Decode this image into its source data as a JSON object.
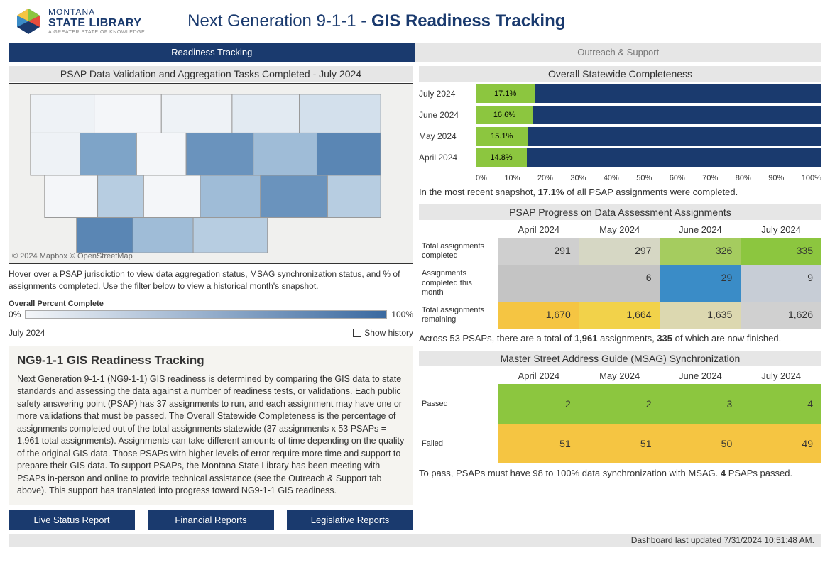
{
  "logo": {
    "l1": "MONTANA",
    "l2": "STATE LIBRARY",
    "l3": "A GREATER STATE OF KNOWLEDGE"
  },
  "page_title_prefix": "Next Generation 9-1-1 - ",
  "page_title_bold": "GIS Readiness Tracking",
  "tabs": {
    "active": "Readiness Tracking",
    "inactive": "Outreach & Support"
  },
  "map": {
    "title": "PSAP Data Validation and Aggregation Tasks Completed - July 2024",
    "attribution": "© 2024 Mapbox © OpenStreetMap",
    "help": "Hover over a PSAP jurisdiction to view data aggregation status, MSAG synchronization status, and % of assignments completed. Use the filter below to view a historical month's snapshot.",
    "legend_title": "Overall Percent Complete",
    "legend_min": "0%",
    "legend_max": "100%",
    "month": "July 2024",
    "show_history": "Show history"
  },
  "info": {
    "heading": "NG9-1-1 GIS Readiness Tracking",
    "body": "Next Generation 9-1-1 (NG9-1-1) GIS readiness is determined by comparing the GIS data to state standards and assessing the data against a number of readiness tests, or validations. Each public safety answering point (PSAP) has 37 assignments to run, and each assignment may have one or more validations that must be passed. The Overall Statewide Completeness is the percentage of assignments completed out of the total assignments statewide (37 assignments x 53 PSAPs = 1,961 total assignments). Assignments can take different amounts of time depending on the quality of the original GIS data. Those PSAPs with higher levels of error require more time and support to prepare their GIS data. To support PSAPs, the Montana State Library has been meeting with PSAPs in-person and online to provide technical assistance (see the Outreach & Support tab above).  This support has translated into progress toward NG9-1-1 GIS readiness."
  },
  "buttons": {
    "b1": "Live Status Report",
    "b2": "Financial Reports",
    "b3": "Legislative Reports"
  },
  "completeness": {
    "title": "Overall Statewide Completeness",
    "rows": [
      {
        "label": "July 2024",
        "pct": 17.1
      },
      {
        "label": "June 2024",
        "pct": 16.6
      },
      {
        "label": "May 2024",
        "pct": 15.1
      },
      {
        "label": "April 2024",
        "pct": 14.8
      }
    ],
    "axis": [
      "0%",
      "10%",
      "20%",
      "30%",
      "40%",
      "50%",
      "60%",
      "70%",
      "80%",
      "90%",
      "100%"
    ],
    "summary_prefix": "In the most recent snapshot, ",
    "summary_bold": "17.1%",
    "summary_suffix": " of all PSAP assignments were completed."
  },
  "progress": {
    "title": "PSAP Progress on Data Assessment Assignments",
    "months": [
      "April 2024",
      "May 2024",
      "June 2024",
      "July 2024"
    ],
    "rows": [
      {
        "label": "Total assignments completed",
        "vals": [
          "291",
          "297",
          "326",
          "335"
        ],
        "colors": [
          "#cfcfcf",
          "#d6d7c4",
          "#a5cc5f",
          "#8cc63f"
        ]
      },
      {
        "label": "Assignments completed this month",
        "vals": [
          "",
          "6",
          "29",
          "9"
        ],
        "colors": [
          "#c4c4c4",
          "#c4c4c4",
          "#3a8cc7",
          "#c7cdd6"
        ]
      },
      {
        "label": "Total assignments remaining",
        "vals": [
          "1,670",
          "1,664",
          "1,635",
          "1,626"
        ],
        "colors": [
          "#f5c542",
          "#f2d24a",
          "#dcd8b0",
          "#d0d0d0"
        ]
      }
    ],
    "summary_p1": "Across 53 PSAPs, there are a total of ",
    "summary_b1": "1,961",
    "summary_p2": " assignments, ",
    "summary_b2": "335",
    "summary_p3": " of which are now finished."
  },
  "msag": {
    "title": "Master Street Address Guide (MSAG) Synchronization",
    "months": [
      "April 2024",
      "May 2024",
      "June 2024",
      "July 2024"
    ],
    "rows": [
      {
        "label": "Passed",
        "vals": [
          "2",
          "2",
          "3",
          "4"
        ],
        "colors": [
          "#8cc63f",
          "#8cc63f",
          "#8cc63f",
          "#8cc63f"
        ]
      },
      {
        "label": "Failed",
        "vals": [
          "51",
          "51",
          "50",
          "49"
        ],
        "colors": [
          "#f5c542",
          "#f5c542",
          "#f5c542",
          "#f5c542"
        ]
      }
    ],
    "summary_p1": "To pass, PSAPs must have 98 to 100% data synchronization with MSAG. ",
    "summary_b1": "4",
    "summary_p2": " PSAPs passed."
  },
  "footer": "Dashboard last updated 7/31/2024 10:51:48 AM.",
  "chart_data": [
    {
      "type": "bar",
      "title": "Overall Statewide Completeness",
      "orientation": "horizontal",
      "categories": [
        "July 2024",
        "June 2024",
        "May 2024",
        "April 2024"
      ],
      "values": [
        17.1,
        16.6,
        15.1,
        14.8
      ],
      "xlim": [
        0,
        100
      ],
      "xlabel": "%"
    },
    {
      "type": "heatmap",
      "title": "PSAP Progress on Data Assessment Assignments",
      "x": [
        "April 2024",
        "May 2024",
        "June 2024",
        "July 2024"
      ],
      "y": [
        "Total assignments completed",
        "Assignments completed this month",
        "Total assignments remaining"
      ],
      "z": [
        [
          291,
          297,
          326,
          335
        ],
        [
          null,
          6,
          29,
          9
        ],
        [
          1670,
          1664,
          1635,
          1626
        ]
      ]
    },
    {
      "type": "heatmap",
      "title": "Master Street Address Guide (MSAG) Synchronization",
      "x": [
        "April 2024",
        "May 2024",
        "June 2024",
        "July 2024"
      ],
      "y": [
        "Passed",
        "Failed"
      ],
      "z": [
        [
          2,
          2,
          3,
          4
        ],
        [
          51,
          51,
          50,
          49
        ]
      ]
    }
  ]
}
